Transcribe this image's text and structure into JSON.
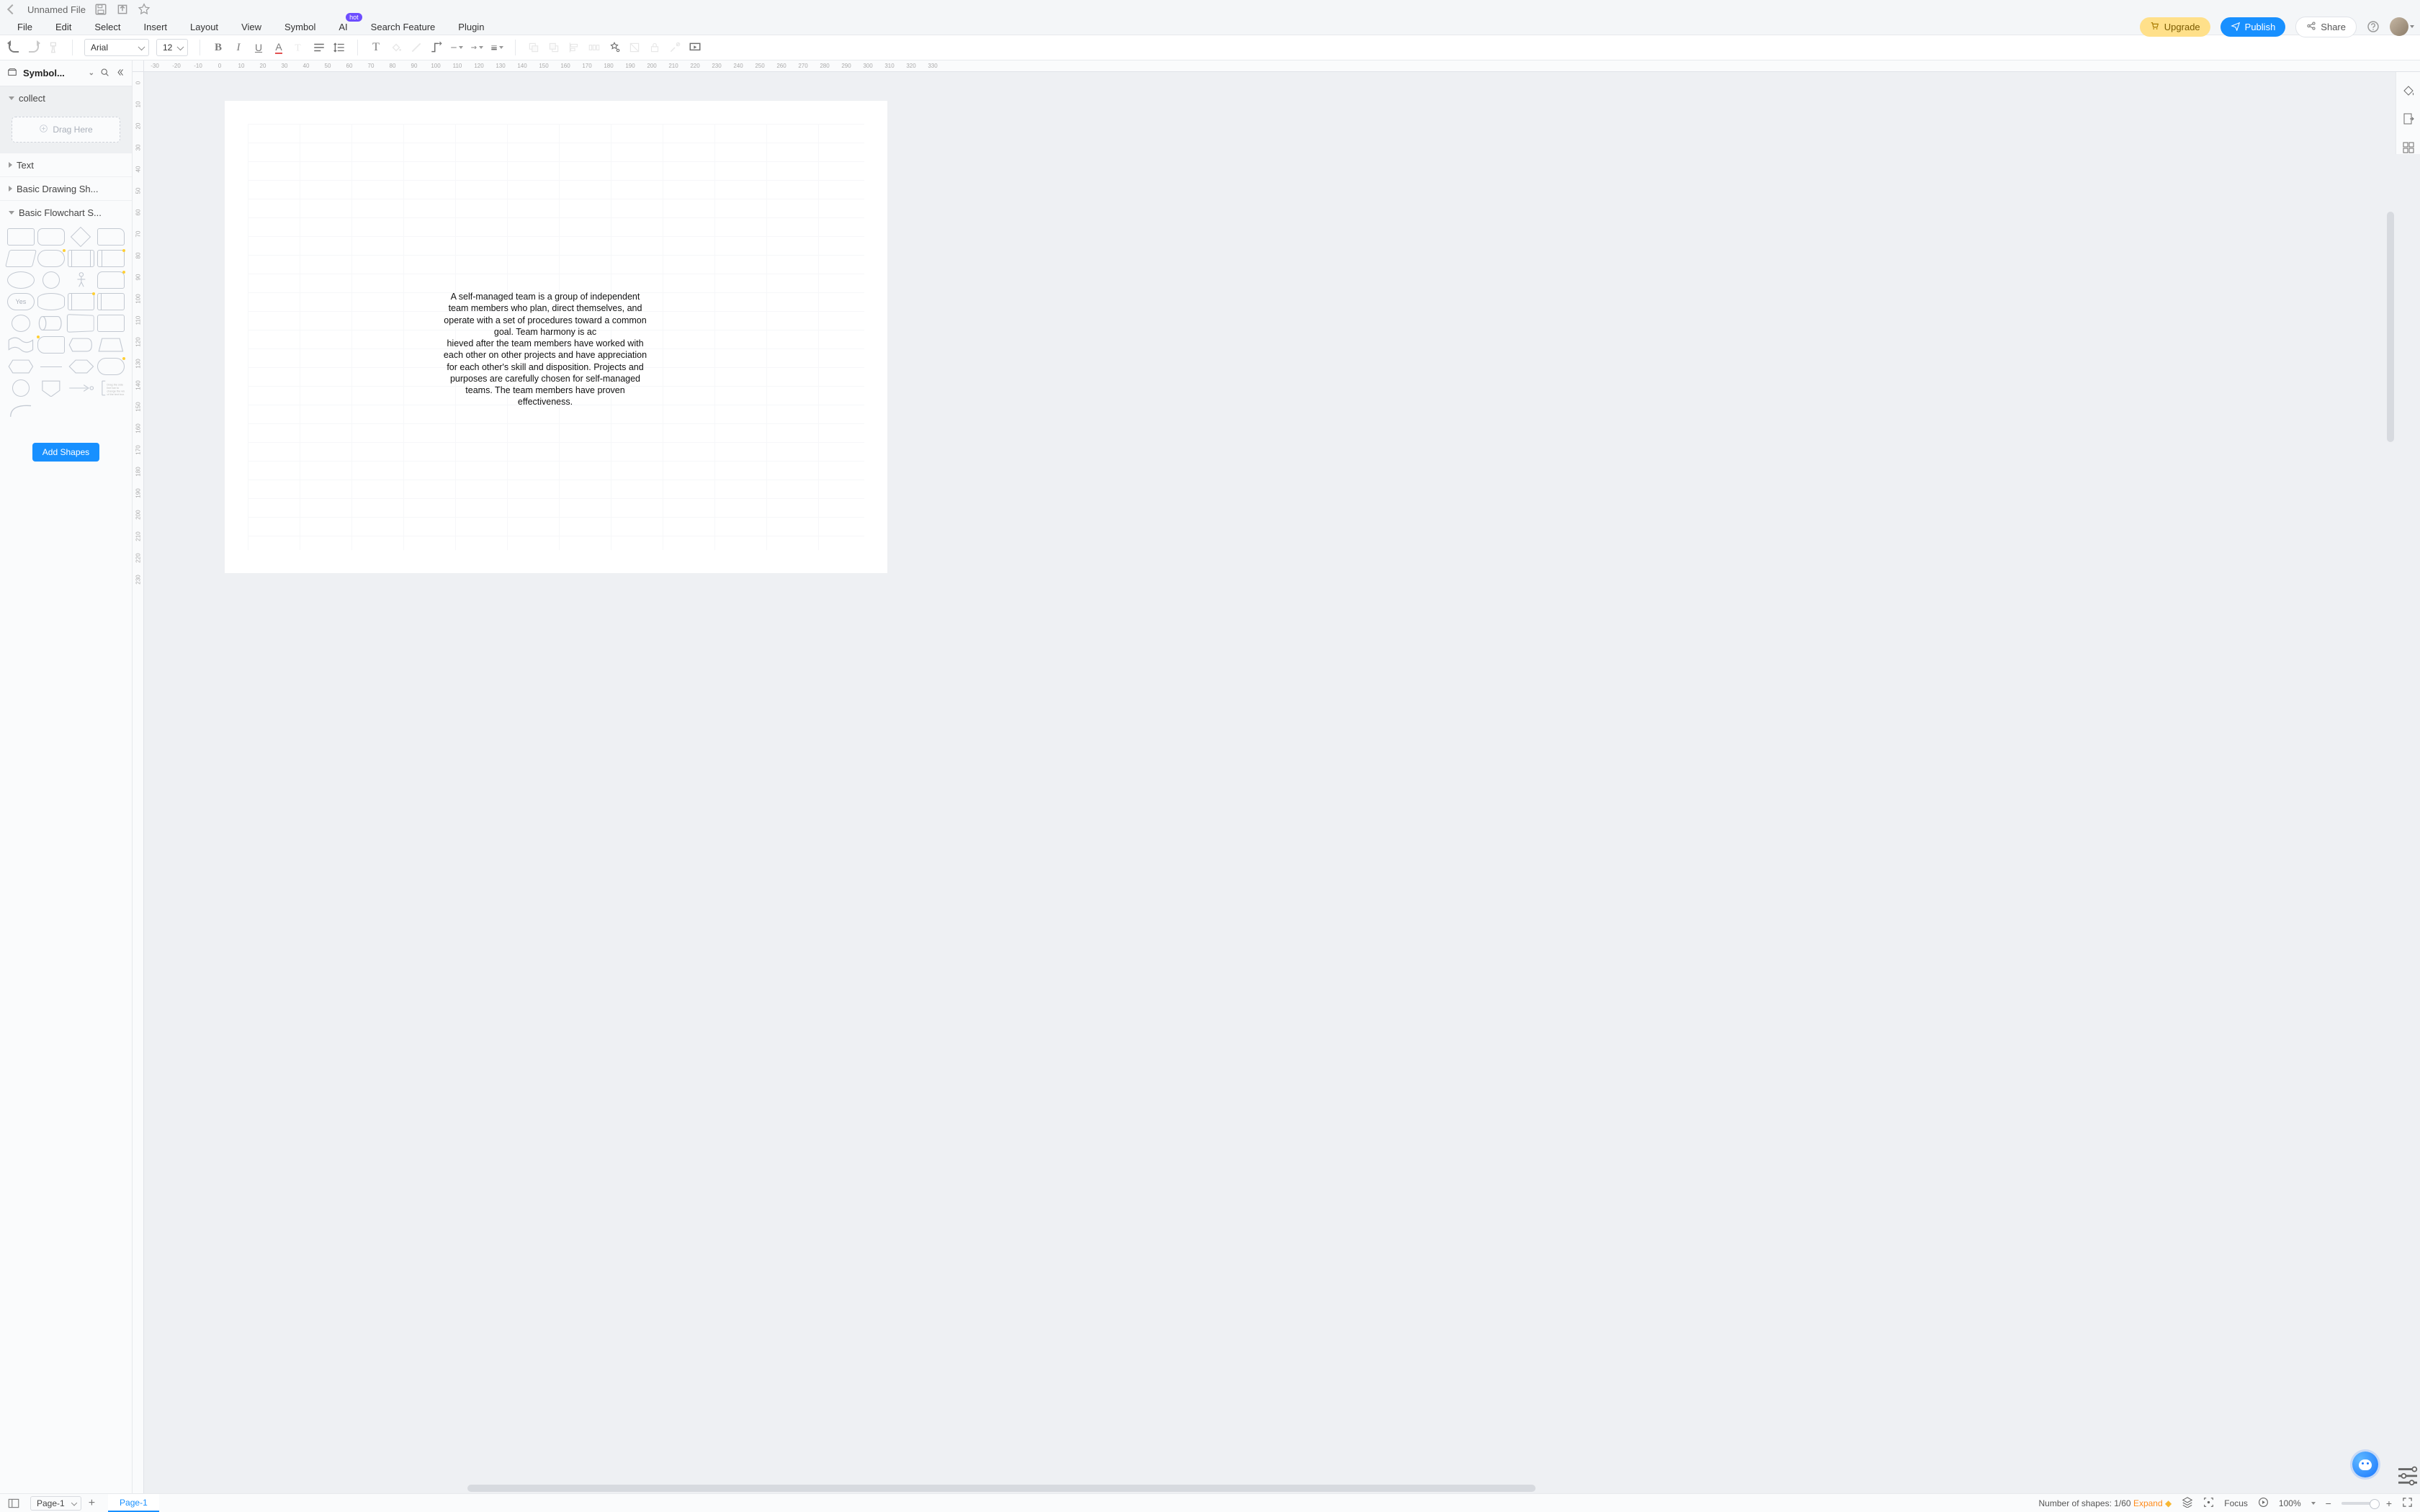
{
  "titlebar": {
    "doc_title": "Unnamed File"
  },
  "menus": {
    "file": "File",
    "edit": "Edit",
    "select": "Select",
    "insert": "Insert",
    "layout": "Layout",
    "view": "View",
    "symbol": "Symbol",
    "ai": "AI",
    "ai_badge": "hot",
    "search_feature": "Search Feature",
    "plugin": "Plugin"
  },
  "topright": {
    "upgrade": "Upgrade",
    "publish": "Publish",
    "share": "Share"
  },
  "toolbar": {
    "font_family": "Arial",
    "font_size": "12"
  },
  "left_panel": {
    "title": "Symbol...",
    "sections": {
      "collect": {
        "label": "collect",
        "drag_here": "Drag Here"
      },
      "text": {
        "label": "Text"
      },
      "basic_drawing": {
        "label": "Basic Drawing Sh..."
      },
      "basic_flowchart": {
        "label": "Basic Flowchart S..."
      }
    },
    "yes_label": "Yes",
    "add_shapes": "Add Shapes"
  },
  "rulers": {
    "h": [
      "-30",
      "-20",
      "-10",
      "0",
      "10",
      "20",
      "30",
      "40",
      "50",
      "60",
      "70",
      "80",
      "90",
      "100",
      "110",
      "120",
      "130",
      "140",
      "150",
      "160",
      "170",
      "180",
      "190",
      "200",
      "210",
      "220",
      "230",
      "240",
      "250",
      "260",
      "270",
      "280",
      "290",
      "300",
      "310",
      "320",
      "330"
    ],
    "v": [
      "0",
      "10",
      "20",
      "30",
      "40",
      "50",
      "60",
      "70",
      "80",
      "90",
      "100",
      "110",
      "120",
      "130",
      "140",
      "150",
      "160",
      "170",
      "180",
      "190",
      "200",
      "210",
      "220",
      "230"
    ]
  },
  "canvas": {
    "text_block": "A self-managed team is a group of independent team members who plan, direct themselves, and operate with a set of procedures toward a common goal. Team harmony is ac\nhieved after the team members have worked with each other on other projects and have appreciation for each other's skill and disposition. Projects and purposes are carefully chosen for self-managed teams. The team members have proven effectiveness."
  },
  "bottombar": {
    "page_dropdown": "Page-1",
    "page_tab": "Page-1",
    "shapes_count_label": "Number of shapes:",
    "shapes_count_value": "1/60",
    "expand": "Expand",
    "focus": "Focus",
    "zoom": "100%"
  }
}
